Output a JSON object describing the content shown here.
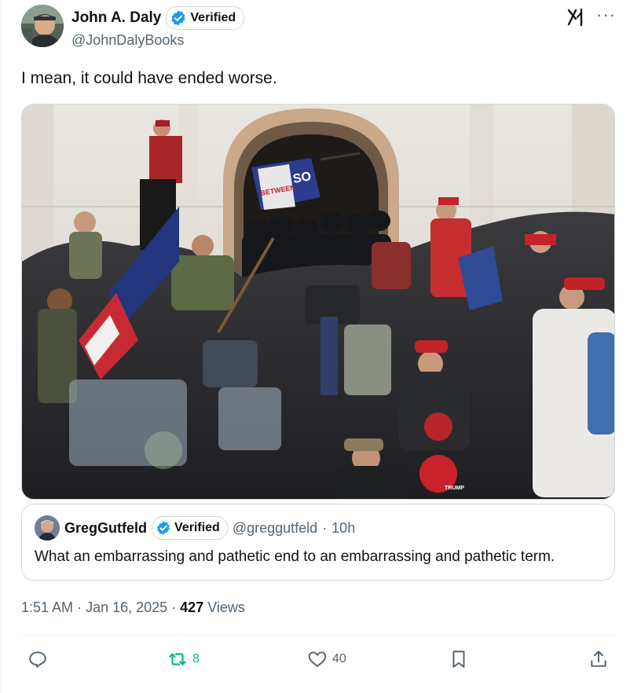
{
  "author": {
    "name": "John A. Daly",
    "verified_label": "Verified",
    "handle": "@JohnDalyBooks"
  },
  "post": {
    "text": "I mean, it could have ended worse.",
    "time": "1:51 AM",
    "date": "Jan 16, 2025",
    "views_count": "427",
    "views_label": "Views"
  },
  "quoted": {
    "name": "GregGutfeld",
    "verified_label": "Verified",
    "handle": "@greggutfeld",
    "age": "10h",
    "text": "What an embarrassing and pathetic end to an embarrassing and pathetic term."
  },
  "actions": {
    "replies": "",
    "reposts": "8",
    "likes": "40"
  },
  "icons": [
    "grok-icon",
    "more-icon",
    "verified-icon",
    "reply-icon",
    "repost-icon",
    "like-icon",
    "bookmark-icon",
    "share-icon"
  ],
  "colors": {
    "verified": "#1d9bf0",
    "repost": "#00ba7c",
    "muted": "#536471"
  },
  "photo_text": [
    "SO",
    "BETWEEN",
    "TRUMP"
  ]
}
